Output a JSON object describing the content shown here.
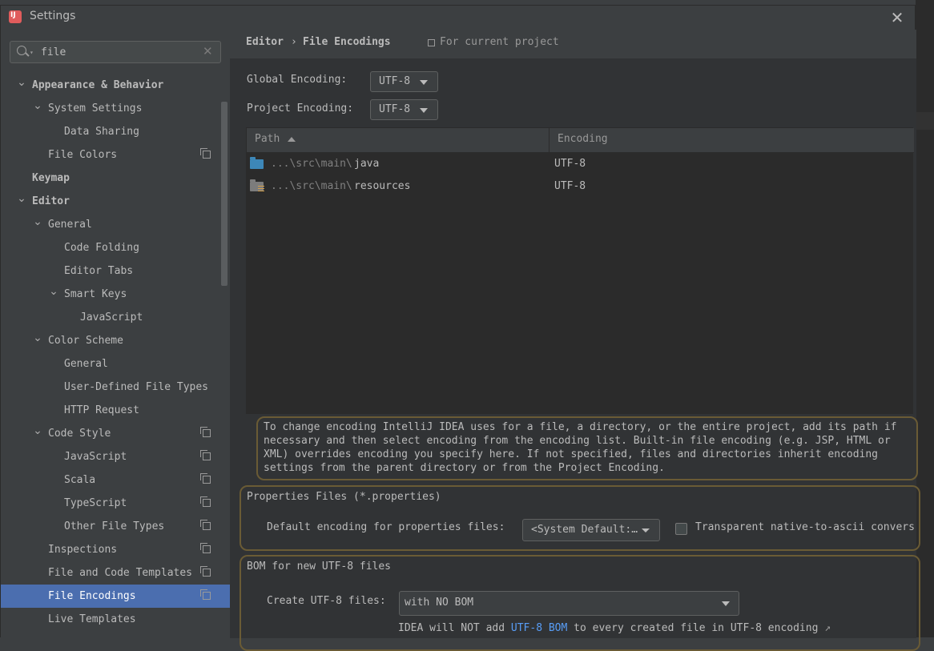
{
  "window": {
    "title": "Settings",
    "close_glyph": "✕"
  },
  "search": {
    "value": "file",
    "clear_glyph": "✕"
  },
  "tree": [
    {
      "label": "Appearance & Behavior",
      "level": 0,
      "expanded": true,
      "bold": true
    },
    {
      "label": "System Settings",
      "level": 1,
      "expanded": true
    },
    {
      "label": "Data Sharing",
      "level": 2
    },
    {
      "label": "File Colors",
      "level": 1,
      "project": true
    },
    {
      "label": "Keymap",
      "level": 0,
      "bold": true
    },
    {
      "label": "Editor",
      "level": 0,
      "expanded": true,
      "bold": true
    },
    {
      "label": "General",
      "level": 1,
      "expanded": true
    },
    {
      "label": "Code Folding",
      "level": 2
    },
    {
      "label": "Editor Tabs",
      "level": 2
    },
    {
      "label": "Smart Keys",
      "level": 2,
      "expanded": true
    },
    {
      "label": "JavaScript",
      "level": 3
    },
    {
      "label": "Color Scheme",
      "level": 1,
      "expanded": true
    },
    {
      "label": "General",
      "level": 2
    },
    {
      "label": "User-Defined File Types",
      "level": 2
    },
    {
      "label": "HTTP Request",
      "level": 2
    },
    {
      "label": "Code Style",
      "level": 1,
      "expanded": true,
      "project": true
    },
    {
      "label": "JavaScript",
      "level": 2,
      "project": true
    },
    {
      "label": "Scala",
      "level": 2,
      "project": true
    },
    {
      "label": "TypeScript",
      "level": 2,
      "project": true
    },
    {
      "label": "Other File Types",
      "level": 2,
      "project": true
    },
    {
      "label": "Inspections",
      "level": 1,
      "project": true
    },
    {
      "label": "File and Code Templates",
      "level": 1,
      "project": true
    },
    {
      "label": "File Encodings",
      "level": 1,
      "project": true,
      "selected": true
    },
    {
      "label": "Live Templates",
      "level": 1
    }
  ],
  "breadcrumb": {
    "parent": "Editor",
    "separator": "›",
    "current": "File Encodings",
    "scope": "For current project"
  },
  "encodings": {
    "global_label": "Global Encoding:",
    "global_value": "UTF-8",
    "project_label": "Project Encoding:",
    "project_value": "UTF-8"
  },
  "table": {
    "columns": [
      "Path",
      "Encoding"
    ],
    "rows": [
      {
        "path_prefix": "...\\src\\main\\",
        "path_name": "java",
        "encoding": "UTF-8",
        "icon": "folder-source-icon"
      },
      {
        "path_prefix": "...\\src\\main\\",
        "path_name": "resources",
        "encoding": "UTF-8",
        "icon": "folder-resources-icon"
      }
    ]
  },
  "hint": {
    "lines": [
      "To change encoding IntelliJ IDEA uses for a file, a directory, or the entire project, add its path if",
      "necessary and then select encoding from the encoding list. Built-in file encoding (e.g. JSP, HTML or",
      "XML) overrides encoding you specify here. If not specified, files and directories inherit encoding",
      "settings from the parent directory or from the Project Encoding."
    ]
  },
  "properties": {
    "title": "Properties Files (*.properties)",
    "default_label": "Default encoding for properties files:",
    "default_value": "<System Default:…",
    "transparent_label": "Transparent native-to-ascii convers",
    "transparent_checked": false
  },
  "bom": {
    "title": "BOM for new UTF-8 files",
    "create_label": "Create UTF-8 files:",
    "create_value": "with NO BOM",
    "note_prefix": "IDEA will NOT add ",
    "note_link": "UTF-8 BOM",
    "note_suffix": " to every created file in UTF-8 encoding",
    "note_arrow": "↗"
  }
}
